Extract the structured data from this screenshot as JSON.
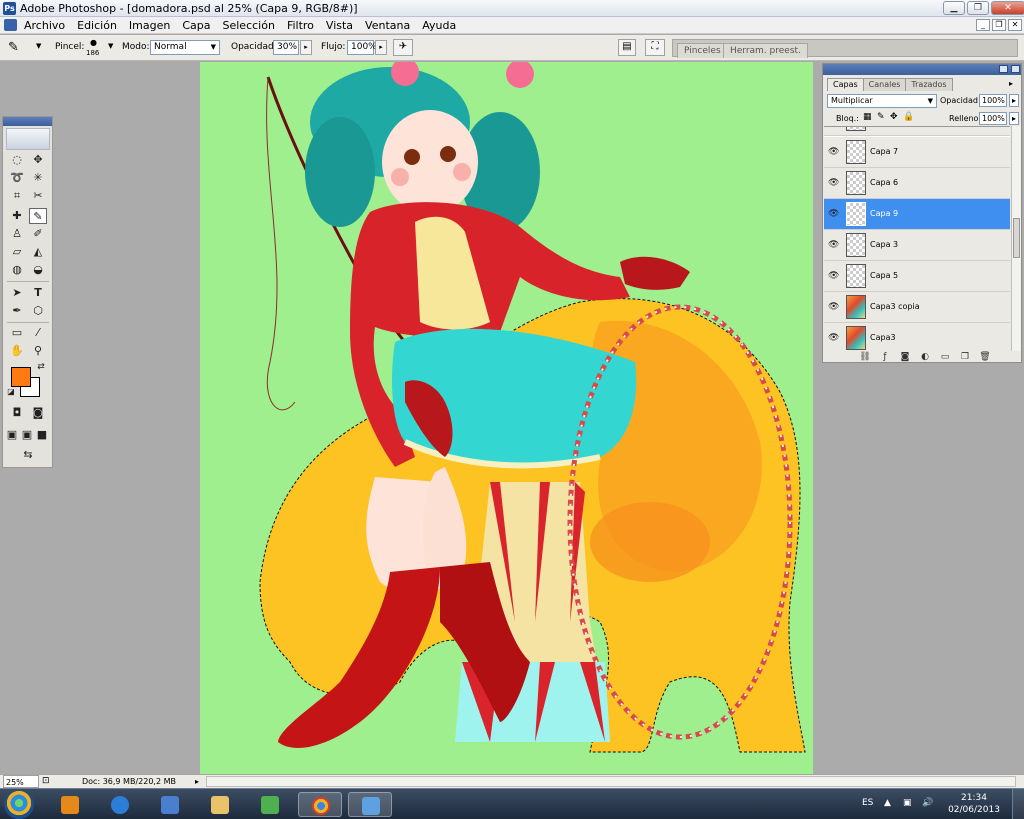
{
  "window": {
    "title": "Adobe Photoshop - [domadora.psd al 25% (Capa 9, RGB/8#)]"
  },
  "menu": [
    "Archivo",
    "Edición",
    "Imagen",
    "Capa",
    "Selección",
    "Filtro",
    "Vista",
    "Ventana",
    "Ayuda"
  ],
  "options": {
    "brush_label": "Pincel:",
    "brush_size": "186",
    "mode_label": "Modo:",
    "mode_value": "Normal",
    "opacity_label": "Opacidad:",
    "opacity_value": "30%",
    "flow_label": "Flujo:",
    "flow_value": "100%",
    "well_tabs": [
      "Pinceles",
      "Herram. preest."
    ]
  },
  "status": {
    "zoom": "25%",
    "doc": "Doc: 36,9 MB/220,2 MB"
  },
  "layers_panel": {
    "tabs": [
      "Capas",
      "Canales",
      "Trazados"
    ],
    "blend_mode": "Multiplicar",
    "opacity_label": "Opacidad:",
    "opacity_value": "100%",
    "lock_label": "Bloq.:",
    "fill_label": "Relleno:",
    "fill_value": "100%",
    "layers": [
      {
        "name": "Capa 7",
        "selected": false,
        "art": false
      },
      {
        "name": "Capa 6",
        "selected": false,
        "art": false
      },
      {
        "name": "Capa 9",
        "selected": true,
        "art": false
      },
      {
        "name": "Capa 3",
        "selected": false,
        "art": false
      },
      {
        "name": "Capa 5",
        "selected": false,
        "art": false
      },
      {
        "name": "Capa3 copia",
        "selected": false,
        "art": true
      },
      {
        "name": "Capa3",
        "selected": false,
        "art": true
      }
    ]
  },
  "tray": {
    "language": "ES",
    "time": "21:34",
    "date": "02/06/2013"
  },
  "colors": {
    "foreground": "#ff7a10",
    "background": "#ffffff",
    "canvas_bg": "#9fef8f",
    "selected_layer": "#3f8ff0"
  }
}
